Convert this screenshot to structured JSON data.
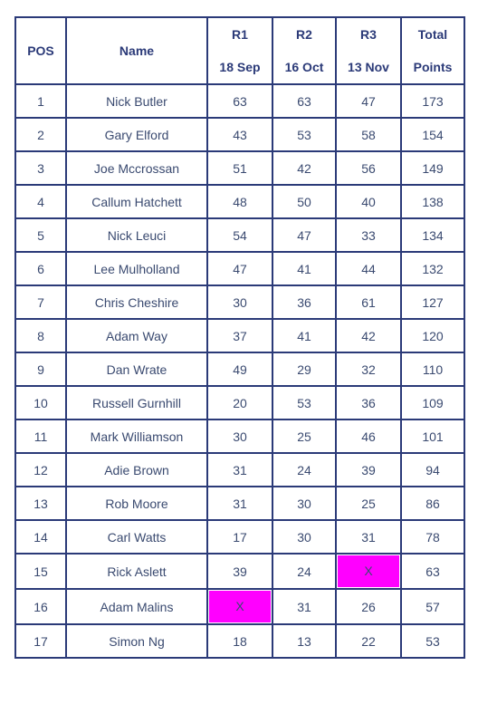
{
  "table": {
    "headers": {
      "pos": "POS",
      "name": "Name",
      "r1": {
        "round": "R1",
        "date": "18 Sep"
      },
      "r2": {
        "round": "R2",
        "date": "16 Oct"
      },
      "r3": {
        "round": "R3",
        "date": "13 Nov"
      },
      "total": {
        "line1": "Total",
        "line2": "Points"
      }
    },
    "highlight_color": "#ff00ff",
    "rows": [
      {
        "pos": "1",
        "name": "Nick Butler",
        "r1": "63",
        "r2": "63",
        "r3": "47",
        "total": "173"
      },
      {
        "pos": "2",
        "name": "Gary Elford",
        "r1": "43",
        "r2": "53",
        "r3": "58",
        "total": "154"
      },
      {
        "pos": "3",
        "name": "Joe Mccrossan",
        "r1": "51",
        "r2": "42",
        "r3": "56",
        "total": "149"
      },
      {
        "pos": "4",
        "name": "Callum Hatchett",
        "r1": "48",
        "r2": "50",
        "r3": "40",
        "total": "138"
      },
      {
        "pos": "5",
        "name": "Nick Leuci",
        "r1": "54",
        "r2": "47",
        "r3": "33",
        "total": "134"
      },
      {
        "pos": "6",
        "name": "Lee Mulholland",
        "r1": "47",
        "r2": "41",
        "r3": "44",
        "total": "132"
      },
      {
        "pos": "7",
        "name": "Chris Cheshire",
        "r1": "30",
        "r2": "36",
        "r3": "61",
        "total": "127"
      },
      {
        "pos": "8",
        "name": "Adam Way",
        "r1": "37",
        "r2": "41",
        "r3": "42",
        "total": "120"
      },
      {
        "pos": "9",
        "name": "Dan Wrate",
        "r1": "49",
        "r2": "29",
        "r3": "32",
        "total": "110"
      },
      {
        "pos": "10",
        "name": "Russell Gurnhill",
        "r1": "20",
        "r2": "53",
        "r3": "36",
        "total": "109"
      },
      {
        "pos": "11",
        "name": "Mark Williamson",
        "r1": "30",
        "r2": "25",
        "r3": "46",
        "total": "101"
      },
      {
        "pos": "12",
        "name": "Adie Brown",
        "r1": "31",
        "r2": "24",
        "r3": "39",
        "total": "94"
      },
      {
        "pos": "13",
        "name": "Rob Moore",
        "r1": "31",
        "r2": "30",
        "r3": "25",
        "total": "86"
      },
      {
        "pos": "14",
        "name": "Carl Watts",
        "r1": "17",
        "r2": "30",
        "r3": "31",
        "total": "78"
      },
      {
        "pos": "15",
        "name": "Rick Aslett",
        "r1": "39",
        "r2": "24",
        "r3": "X",
        "total": "63"
      },
      {
        "pos": "16",
        "name": "Adam Malins",
        "r1": "X",
        "r2": "31",
        "r3": "26",
        "total": "57"
      },
      {
        "pos": "17",
        "name": "Simon Ng",
        "r1": "18",
        "r2": "13",
        "r3": "22",
        "total": "53"
      }
    ]
  }
}
